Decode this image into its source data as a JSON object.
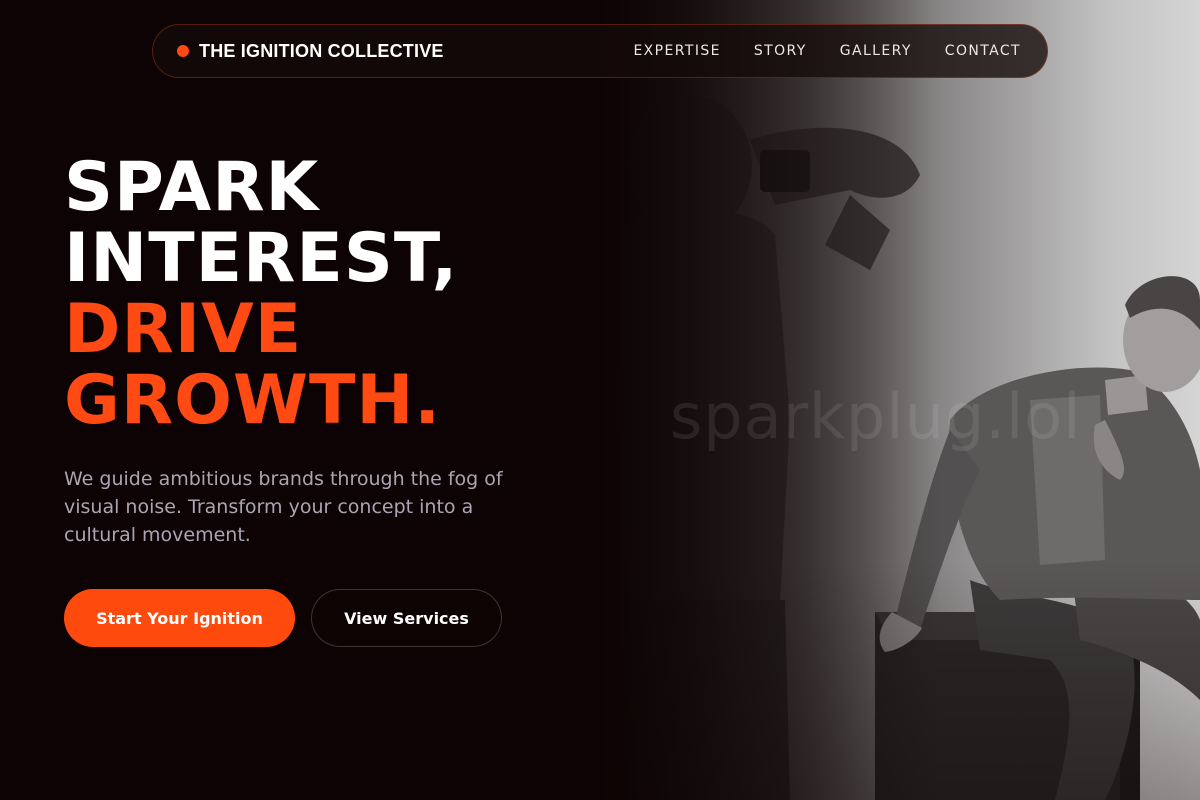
{
  "brand": {
    "name": "THE IGNITION COLLECTIVE",
    "dot_color": "#ff4a14"
  },
  "nav": {
    "links": [
      {
        "label": "EXPERTISE"
      },
      {
        "label": "STORY"
      },
      {
        "label": "GALLERY"
      },
      {
        "label": "CONTACT"
      }
    ]
  },
  "hero": {
    "headline": {
      "line1": "SPARK",
      "line2": "INTEREST,",
      "line3": "DRIVE",
      "line4": "GROWTH."
    },
    "subtitle": "We guide ambitious brands through the fog of visual noise. Transform your concept into a cultural movement.",
    "primary_cta": "Start Your Ignition",
    "secondary_cta": "View Services",
    "watermark": "sparkplug.lol",
    "photo_icon": "photographer-and-model-photo"
  },
  "colors": {
    "background": "#0d0304",
    "accent": "#ff4a14",
    "text_primary": "#ffffff",
    "text_muted": "#a9a6b3"
  }
}
